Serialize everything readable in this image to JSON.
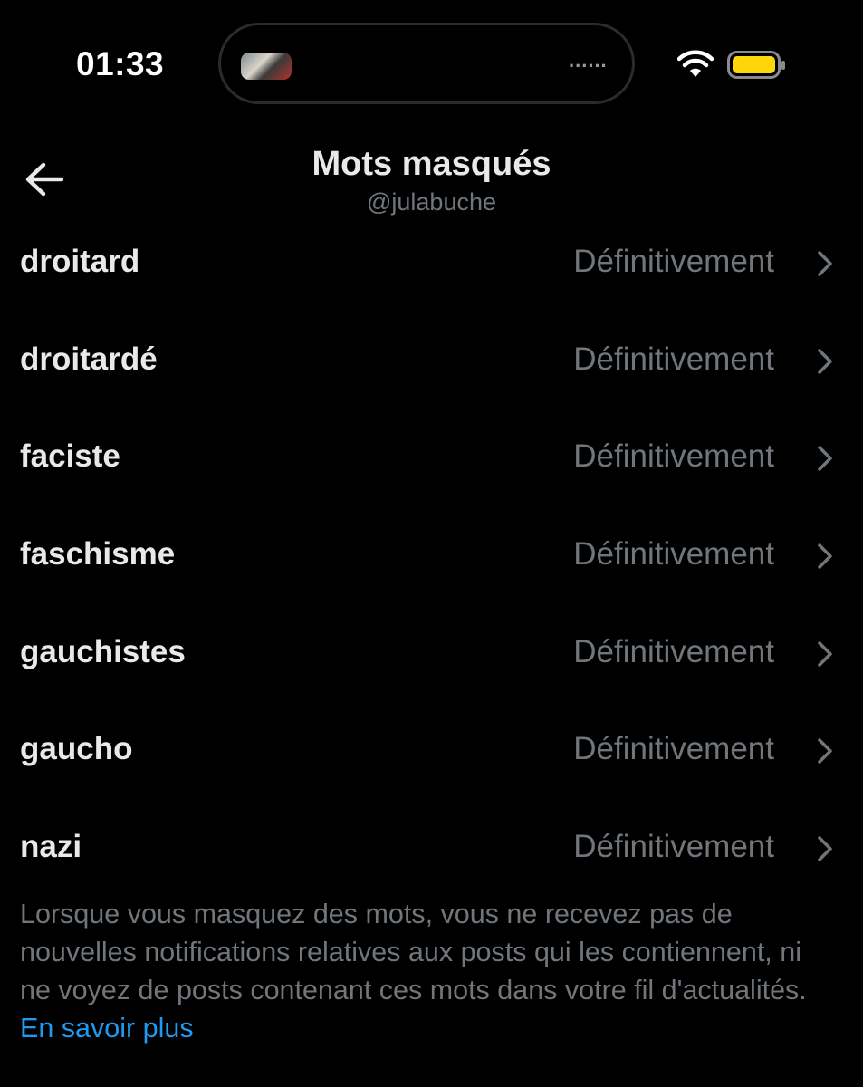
{
  "status_bar": {
    "time": "01:33",
    "island_dots": "......",
    "battery_color": "#ffd60a",
    "icons": [
      "wifi-icon",
      "battery-icon"
    ]
  },
  "header": {
    "title": "Mots masqués",
    "subtitle": "@julabuche",
    "back_icon": "arrow-left-icon"
  },
  "muted_words": [
    {
      "word": "droitard",
      "duration": "Définitivement"
    },
    {
      "word": "droitardé",
      "duration": "Définitivement"
    },
    {
      "word": "faciste",
      "duration": "Définitivement"
    },
    {
      "word": "faschisme",
      "duration": "Définitivement"
    },
    {
      "word": "gauchistes",
      "duration": "Définitivement"
    },
    {
      "word": "gaucho",
      "duration": "Définitivement"
    },
    {
      "word": "nazi",
      "duration": "Définitivement"
    }
  ],
  "footer": {
    "info": "Lorsque vous masquez des mots, vous ne recevez pas de nouvelles notifications relatives aux posts qui les contiennent, ni ne voyez de posts contenant ces mots dans votre fil d'actualités.",
    "learn_more": "En savoir plus",
    "link_color": "#1d9bf0"
  }
}
